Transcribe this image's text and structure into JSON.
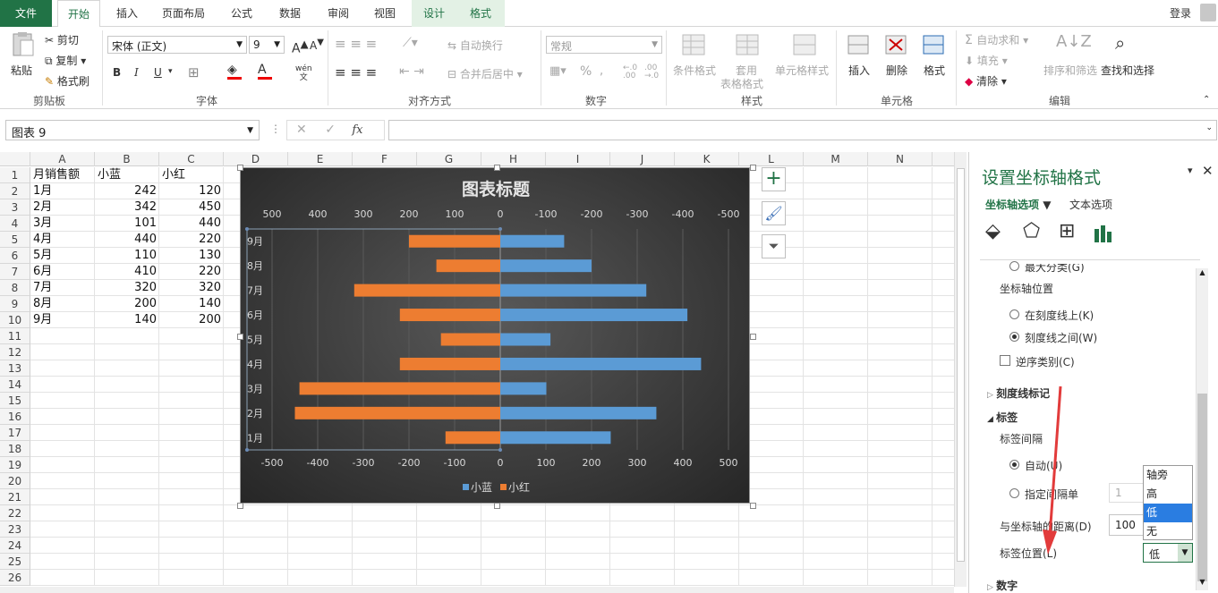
{
  "tabs": {
    "file": "文件",
    "home": "开始",
    "insert": "插入",
    "layout": "页面布局",
    "formula": "公式",
    "data": "数据",
    "review": "审阅",
    "view": "视图",
    "design": "设计",
    "format": "格式",
    "login": "登录"
  },
  "ribbon": {
    "clipboard": {
      "paste": "粘贴",
      "cut": "剪切",
      "copy": "复制",
      "painter": "格式刷",
      "label": "剪贴板"
    },
    "font": {
      "name": "宋体 (正文)",
      "size": "9",
      "bold": "B",
      "italic": "I",
      "underline": "U",
      "label": "字体",
      "wen": "wén"
    },
    "align": {
      "wrap": "自动换行",
      "merge": "合并后居中",
      "label": "对齐方式"
    },
    "number": {
      "format": "常规",
      "percent": "%",
      "label": "数字"
    },
    "styles": {
      "cond": "条件格式",
      "table1": "套用",
      "table2": "表格格式",
      "cellstyle": "单元格样式",
      "label": "样式"
    },
    "cells": {
      "insert": "插入",
      "delete": "删除",
      "format": "格式",
      "label": "单元格"
    },
    "edit": {
      "autosum": "自动求和",
      "fill": "填充",
      "clear": "清除",
      "sort": "排序和筛选",
      "find": "查找和选择",
      "label": "编辑"
    }
  },
  "formula_bar": {
    "namebox": "图表 9",
    "fx": "fx"
  },
  "columns": [
    "A",
    "B",
    "C",
    "D",
    "E",
    "F",
    "G",
    "H",
    "I",
    "J",
    "K",
    "L",
    "M",
    "N"
  ],
  "rows": [
    "1",
    "2",
    "3",
    "4",
    "5",
    "6",
    "7",
    "8",
    "9",
    "10",
    "11",
    "12",
    "13",
    "14",
    "15",
    "16",
    "17",
    "18",
    "19",
    "20",
    "21",
    "22",
    "23",
    "24",
    "25",
    "26"
  ],
  "sheet": {
    "header": [
      "月销售额",
      "小蓝",
      "小红"
    ],
    "data": [
      [
        "1月",
        "242",
        "120"
      ],
      [
        "2月",
        "342",
        "450"
      ],
      [
        "3月",
        "101",
        "440"
      ],
      [
        "4月",
        "440",
        "220"
      ],
      [
        "5月",
        "110",
        "130"
      ],
      [
        "6月",
        "410",
        "220"
      ],
      [
        "7月",
        "320",
        "320"
      ],
      [
        "8月",
        "200",
        "140"
      ],
      [
        "9月",
        "140",
        "200"
      ]
    ]
  },
  "chart_data": {
    "type": "bar",
    "title": "图表标题",
    "categories": [
      "1月",
      "2月",
      "3月",
      "4月",
      "5月",
      "6月",
      "7月",
      "8月",
      "9月"
    ],
    "series": [
      {
        "name": "小蓝",
        "values": [
          242,
          342,
          101,
          440,
          110,
          410,
          320,
          200,
          140
        ],
        "color": "#5b9bd5"
      },
      {
        "name": "小红",
        "values": [
          -120,
          -450,
          -440,
          -220,
          -130,
          -220,
          -320,
          -140,
          -200
        ],
        "color": "#ed7d31"
      }
    ],
    "xlim": [
      -500,
      500
    ],
    "bottom_ticks": [
      "-500",
      "-400",
      "-300",
      "-200",
      "-100",
      "0",
      "100",
      "200",
      "300",
      "400",
      "500"
    ],
    "top_ticks": [
      "500",
      "400",
      "300",
      "200",
      "100",
      "0",
      "-100",
      "-200",
      "-300",
      "-400",
      "-500"
    ],
    "legend": "bottom",
    "grid": true
  },
  "pane": {
    "title": "设置坐标轴格式",
    "tab_axis": "坐标轴选项",
    "tab_text": "文本选项",
    "cut_option": "最大分类(G)",
    "axis_position": "坐标轴位置",
    "on_tick": "在刻度线上(K)",
    "between": "刻度线之间(W)",
    "reverse": "逆序类别(C)",
    "tickmarks": "刻度线标记",
    "labels": "标签",
    "interval": "标签间隔",
    "auto": "自动(U)",
    "specify": "指定间隔单",
    "specify_val": "1",
    "distance": "与坐标轴的距离(D)",
    "distance_val": "100",
    "label_pos": "标签位置(L)",
    "label_pos_val": "低",
    "number": "数字",
    "dropdown": [
      "轴旁",
      "高",
      "低",
      "无"
    ]
  }
}
